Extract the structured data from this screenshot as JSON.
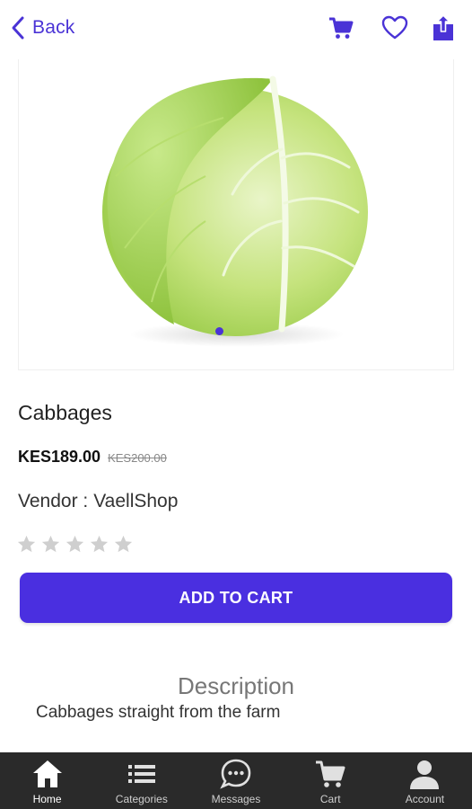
{
  "colors": {
    "accent": "#4a2fe0",
    "nav_bg": "#2a2a2a",
    "star_empty": "#cfcfcf"
  },
  "header": {
    "back_label": "Back",
    "icons": [
      "cart-icon",
      "heart-icon",
      "share-icon"
    ]
  },
  "product": {
    "image_alt": "cabbage",
    "carousel": {
      "current": 1,
      "total": 1
    },
    "name": "Cabbages",
    "price": "KES189.00",
    "old_price": "KES200.00",
    "vendor_prefix": "Vendor :",
    "vendor_name": "VaellShop",
    "rating": {
      "value": 0,
      "max": 5
    }
  },
  "actions": {
    "add_to_cart": "ADD TO CART"
  },
  "description": {
    "heading": "Description",
    "text": "Cabbages straight from the farm"
  },
  "bottom_nav": {
    "active": "Home",
    "items": [
      {
        "label": "Home",
        "icon": "home-icon"
      },
      {
        "label": "Categories",
        "icon": "list-icon"
      },
      {
        "label": "Messages",
        "icon": "chat-icon"
      },
      {
        "label": "Cart",
        "icon": "cart-icon"
      },
      {
        "label": "Account",
        "icon": "person-icon"
      }
    ]
  }
}
